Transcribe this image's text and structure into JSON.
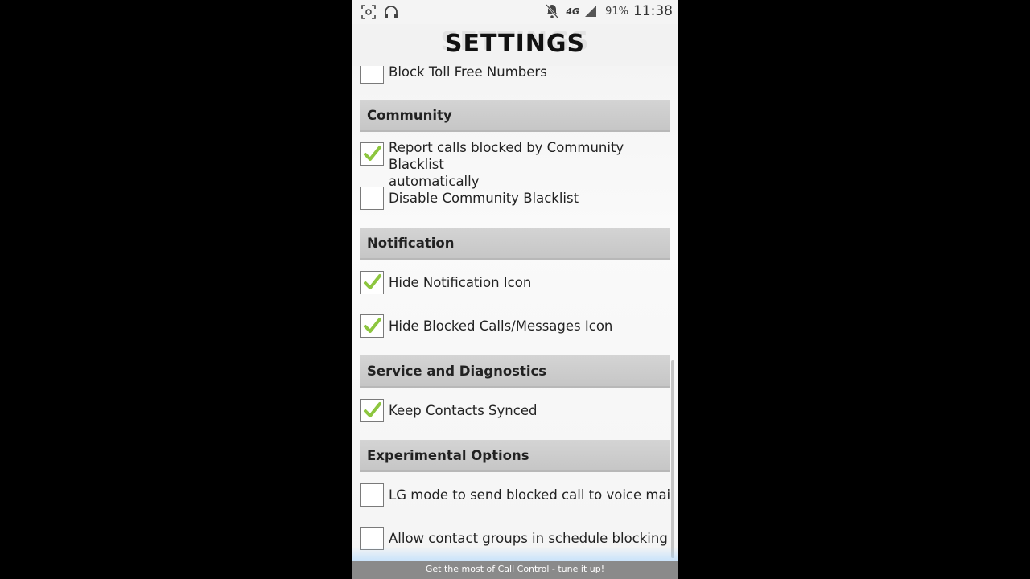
{
  "status_bar": {
    "battery": "91%",
    "time": "11:38",
    "network": "4G",
    "icons": [
      "screenshot-icon",
      "headphones-icon",
      "bell-muted-icon",
      "network-4g-icon",
      "signal-icon"
    ]
  },
  "title": "SETTINGS",
  "items": {
    "block_toll_free": {
      "label": "Block Toll Free Numbers",
      "checked": false
    },
    "report_calls": {
      "label_line1": "Report calls blocked by Community Blacklist",
      "label_line2": "automatically",
      "checked": true
    },
    "disable_blacklist": {
      "label": "Disable Community Blacklist",
      "checked": false
    },
    "hide_notification": {
      "label": "Hide Notification Icon",
      "checked": true
    },
    "hide_blocked": {
      "label": "Hide Blocked Calls/Messages Icon",
      "checked": true
    },
    "keep_contacts": {
      "label": "Keep Contacts Synced",
      "checked": true
    },
    "lg_mode": {
      "label": "LG mode to send blocked call to voice mail",
      "checked": false
    },
    "allow_groups": {
      "label": "Allow contact groups in schedule blocking",
      "checked": false
    }
  },
  "sections": {
    "community": "Community",
    "notification": "Notification",
    "service": "Service and Diagnostics",
    "experimental": "Experimental Options"
  },
  "footer": "Get the most of Call Control - tune it up!",
  "colors": {
    "checkmark": "#8dc63f",
    "section_bg": "#cccccc",
    "footer_bg": "#8a8a8a"
  }
}
